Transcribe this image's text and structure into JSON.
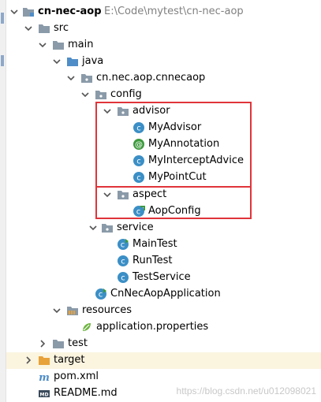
{
  "project": {
    "name": "cn-nec-aop",
    "path": "E:\\Code\\mytest\\cn-nec-aop"
  },
  "tree": {
    "src": "src",
    "main": "main",
    "java": "java",
    "package": "cn.nec.aop.cnnecaop",
    "config": "config",
    "advisor": "advisor",
    "advisor_items": [
      "MyAdvisor",
      "MyAnnotation",
      "MyInterceptAdvice",
      "MyPointCut"
    ],
    "aspect": "aspect",
    "aspect_items": [
      "AopConfig"
    ],
    "service": "service",
    "service_items": [
      "MainTest",
      "RunTest",
      "TestService"
    ],
    "application": "CnNecAopApplication",
    "resources": "resources",
    "resource_items": [
      "application.properties"
    ],
    "test": "test",
    "target": "target",
    "pom": "pom.xml",
    "readme": "README.md"
  },
  "watermark": "https://blog.csdn.net/u012098021",
  "colors": {
    "highlight_box": "#e0343a",
    "class_icon": "#3b8fc6",
    "annotation_icon": "#3e9a3e",
    "folder": "#8a9aa8",
    "source_folder": "#4f8dc8",
    "excluded_folder": "#e8a23a"
  }
}
